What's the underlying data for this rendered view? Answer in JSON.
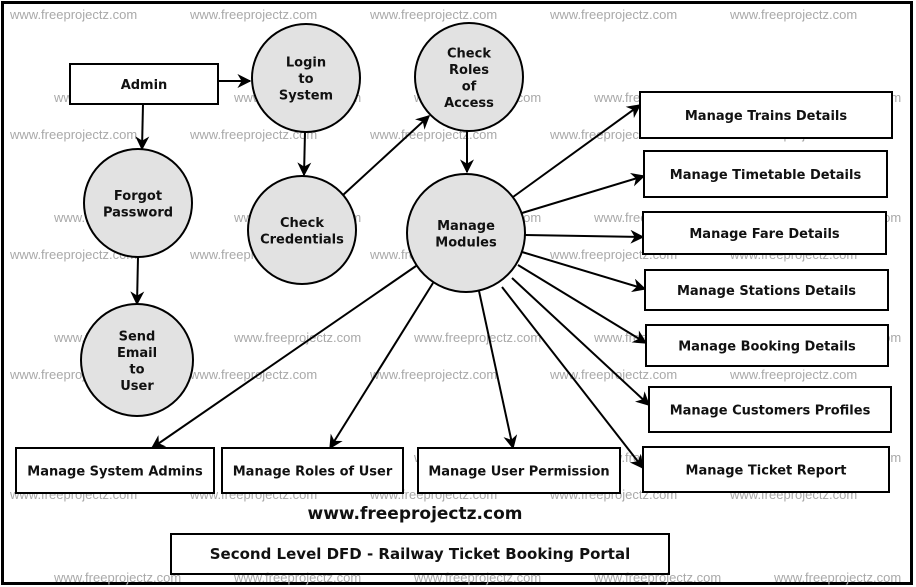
{
  "diagram": {
    "title": "Second Level DFD - Railway Ticket Booking Portal",
    "website": "www.freeprojectz.com",
    "watermark": "www.freeprojectz.com",
    "colors": {
      "process_fill": "#e2e2e2",
      "stroke": "#000000",
      "text": "#111111",
      "watermark": "#a9a9a9",
      "background": "#ffffff"
    },
    "entities": [
      {
        "id": "admin",
        "label": "Admin"
      }
    ],
    "processes": [
      {
        "id": "login",
        "lines": [
          "Login",
          "to",
          "System"
        ]
      },
      {
        "id": "check_roles",
        "lines": [
          "Check",
          "Roles",
          "of",
          "Access"
        ]
      },
      {
        "id": "forgot",
        "lines": [
          "Forgot",
          "Password"
        ]
      },
      {
        "id": "check_credentials",
        "lines": [
          "Check",
          "Credentials"
        ]
      },
      {
        "id": "manage_modules",
        "lines": [
          "Manage",
          "Modules"
        ]
      },
      {
        "id": "send_email",
        "lines": [
          "Send",
          "Email",
          "to",
          "User"
        ]
      }
    ],
    "modules": [
      {
        "id": "trains",
        "label": "Manage Trains Details"
      },
      {
        "id": "timetable",
        "label": "Manage Timetable Details"
      },
      {
        "id": "fare",
        "label": "Manage Fare Details"
      },
      {
        "id": "stations",
        "label": "Manage Stations Details"
      },
      {
        "id": "booking",
        "label": "Manage Booking Details"
      },
      {
        "id": "customers",
        "label": "Manage Customers Profiles"
      },
      {
        "id": "ticket_report",
        "label": "Manage Ticket Report"
      },
      {
        "id": "system_admins",
        "label": "Manage System Admins"
      },
      {
        "id": "roles",
        "label": "Manage Roles of User"
      },
      {
        "id": "permission",
        "label": "Manage User Permission"
      }
    ],
    "flows": [
      {
        "from": "admin",
        "to": "login"
      },
      {
        "from": "admin",
        "to": "forgot"
      },
      {
        "from": "login",
        "to": "check_credentials"
      },
      {
        "from": "check_credentials",
        "to": "check_roles"
      },
      {
        "from": "check_roles",
        "to": "manage_modules"
      },
      {
        "from": "forgot",
        "to": "send_email"
      },
      {
        "from": "manage_modules",
        "to": "trains"
      },
      {
        "from": "manage_modules",
        "to": "timetable"
      },
      {
        "from": "manage_modules",
        "to": "fare"
      },
      {
        "from": "manage_modules",
        "to": "stations"
      },
      {
        "from": "manage_modules",
        "to": "booking"
      },
      {
        "from": "manage_modules",
        "to": "customers"
      },
      {
        "from": "manage_modules",
        "to": "ticket_report"
      },
      {
        "from": "manage_modules",
        "to": "system_admins"
      },
      {
        "from": "manage_modules",
        "to": "roles"
      },
      {
        "from": "manage_modules",
        "to": "permission"
      }
    ]
  }
}
